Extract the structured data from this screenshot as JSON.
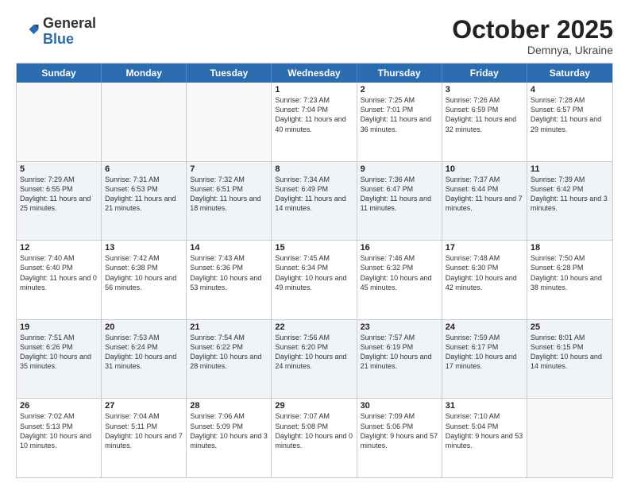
{
  "header": {
    "logo_general": "General",
    "logo_blue": "Blue",
    "month": "October 2025",
    "location": "Demnya, Ukraine"
  },
  "weekdays": [
    "Sunday",
    "Monday",
    "Tuesday",
    "Wednesday",
    "Thursday",
    "Friday",
    "Saturday"
  ],
  "rows": [
    [
      {
        "day": "",
        "empty": true
      },
      {
        "day": "",
        "empty": true
      },
      {
        "day": "",
        "empty": true
      },
      {
        "day": "1",
        "sunrise": "Sunrise: 7:23 AM",
        "sunset": "Sunset: 7:04 PM",
        "daylight": "Daylight: 11 hours and 40 minutes."
      },
      {
        "day": "2",
        "sunrise": "Sunrise: 7:25 AM",
        "sunset": "Sunset: 7:01 PM",
        "daylight": "Daylight: 11 hours and 36 minutes."
      },
      {
        "day": "3",
        "sunrise": "Sunrise: 7:26 AM",
        "sunset": "Sunset: 6:59 PM",
        "daylight": "Daylight: 11 hours and 32 minutes."
      },
      {
        "day": "4",
        "sunrise": "Sunrise: 7:28 AM",
        "sunset": "Sunset: 6:57 PM",
        "daylight": "Daylight: 11 hours and 29 minutes."
      }
    ],
    [
      {
        "day": "5",
        "sunrise": "Sunrise: 7:29 AM",
        "sunset": "Sunset: 6:55 PM",
        "daylight": "Daylight: 11 hours and 25 minutes."
      },
      {
        "day": "6",
        "sunrise": "Sunrise: 7:31 AM",
        "sunset": "Sunset: 6:53 PM",
        "daylight": "Daylight: 11 hours and 21 minutes."
      },
      {
        "day": "7",
        "sunrise": "Sunrise: 7:32 AM",
        "sunset": "Sunset: 6:51 PM",
        "daylight": "Daylight: 11 hours and 18 minutes."
      },
      {
        "day": "8",
        "sunrise": "Sunrise: 7:34 AM",
        "sunset": "Sunset: 6:49 PM",
        "daylight": "Daylight: 11 hours and 14 minutes."
      },
      {
        "day": "9",
        "sunrise": "Sunrise: 7:36 AM",
        "sunset": "Sunset: 6:47 PM",
        "daylight": "Daylight: 11 hours and 11 minutes."
      },
      {
        "day": "10",
        "sunrise": "Sunrise: 7:37 AM",
        "sunset": "Sunset: 6:44 PM",
        "daylight": "Daylight: 11 hours and 7 minutes."
      },
      {
        "day": "11",
        "sunrise": "Sunrise: 7:39 AM",
        "sunset": "Sunset: 6:42 PM",
        "daylight": "Daylight: 11 hours and 3 minutes."
      }
    ],
    [
      {
        "day": "12",
        "sunrise": "Sunrise: 7:40 AM",
        "sunset": "Sunset: 6:40 PM",
        "daylight": "Daylight: 11 hours and 0 minutes."
      },
      {
        "day": "13",
        "sunrise": "Sunrise: 7:42 AM",
        "sunset": "Sunset: 6:38 PM",
        "daylight": "Daylight: 10 hours and 56 minutes."
      },
      {
        "day": "14",
        "sunrise": "Sunrise: 7:43 AM",
        "sunset": "Sunset: 6:36 PM",
        "daylight": "Daylight: 10 hours and 53 minutes."
      },
      {
        "day": "15",
        "sunrise": "Sunrise: 7:45 AM",
        "sunset": "Sunset: 6:34 PM",
        "daylight": "Daylight: 10 hours and 49 minutes."
      },
      {
        "day": "16",
        "sunrise": "Sunrise: 7:46 AM",
        "sunset": "Sunset: 6:32 PM",
        "daylight": "Daylight: 10 hours and 45 minutes."
      },
      {
        "day": "17",
        "sunrise": "Sunrise: 7:48 AM",
        "sunset": "Sunset: 6:30 PM",
        "daylight": "Daylight: 10 hours and 42 minutes."
      },
      {
        "day": "18",
        "sunrise": "Sunrise: 7:50 AM",
        "sunset": "Sunset: 6:28 PM",
        "daylight": "Daylight: 10 hours and 38 minutes."
      }
    ],
    [
      {
        "day": "19",
        "sunrise": "Sunrise: 7:51 AM",
        "sunset": "Sunset: 6:26 PM",
        "daylight": "Daylight: 10 hours and 35 minutes."
      },
      {
        "day": "20",
        "sunrise": "Sunrise: 7:53 AM",
        "sunset": "Sunset: 6:24 PM",
        "daylight": "Daylight: 10 hours and 31 minutes."
      },
      {
        "day": "21",
        "sunrise": "Sunrise: 7:54 AM",
        "sunset": "Sunset: 6:22 PM",
        "daylight": "Daylight: 10 hours and 28 minutes."
      },
      {
        "day": "22",
        "sunrise": "Sunrise: 7:56 AM",
        "sunset": "Sunset: 6:20 PM",
        "daylight": "Daylight: 10 hours and 24 minutes."
      },
      {
        "day": "23",
        "sunrise": "Sunrise: 7:57 AM",
        "sunset": "Sunset: 6:19 PM",
        "daylight": "Daylight: 10 hours and 21 minutes."
      },
      {
        "day": "24",
        "sunrise": "Sunrise: 7:59 AM",
        "sunset": "Sunset: 6:17 PM",
        "daylight": "Daylight: 10 hours and 17 minutes."
      },
      {
        "day": "25",
        "sunrise": "Sunrise: 8:01 AM",
        "sunset": "Sunset: 6:15 PM",
        "daylight": "Daylight: 10 hours and 14 minutes."
      }
    ],
    [
      {
        "day": "26",
        "sunrise": "Sunrise: 7:02 AM",
        "sunset": "Sunset: 5:13 PM",
        "daylight": "Daylight: 10 hours and 10 minutes."
      },
      {
        "day": "27",
        "sunrise": "Sunrise: 7:04 AM",
        "sunset": "Sunset: 5:11 PM",
        "daylight": "Daylight: 10 hours and 7 minutes."
      },
      {
        "day": "28",
        "sunrise": "Sunrise: 7:06 AM",
        "sunset": "Sunset: 5:09 PM",
        "daylight": "Daylight: 10 hours and 3 minutes."
      },
      {
        "day": "29",
        "sunrise": "Sunrise: 7:07 AM",
        "sunset": "Sunset: 5:08 PM",
        "daylight": "Daylight: 10 hours and 0 minutes."
      },
      {
        "day": "30",
        "sunrise": "Sunrise: 7:09 AM",
        "sunset": "Sunset: 5:06 PM",
        "daylight": "Daylight: 9 hours and 57 minutes."
      },
      {
        "day": "31",
        "sunrise": "Sunrise: 7:10 AM",
        "sunset": "Sunset: 5:04 PM",
        "daylight": "Daylight: 9 hours and 53 minutes."
      },
      {
        "day": "",
        "empty": true
      }
    ]
  ]
}
